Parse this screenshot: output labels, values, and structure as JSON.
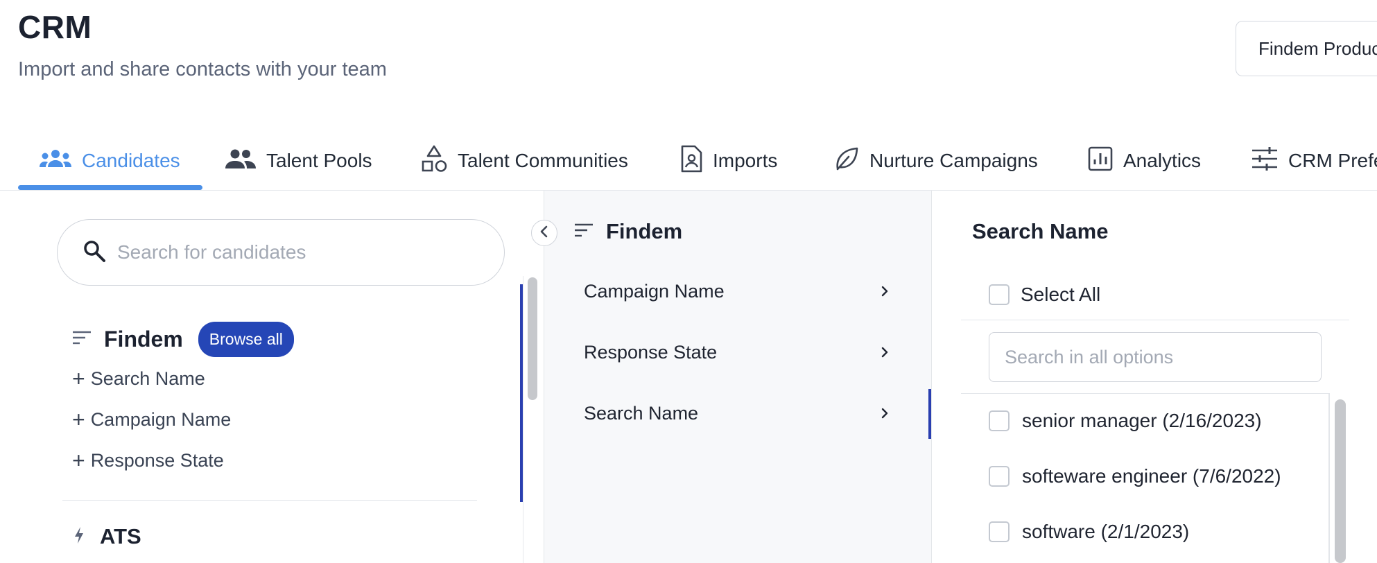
{
  "header": {
    "title": "CRM",
    "subtitle": "Import and share contacts with your team",
    "account_select_label": "Findem Product"
  },
  "tabs": [
    {
      "label": "Candidates",
      "icon": "people-group-icon",
      "active": true
    },
    {
      "label": "Talent Pools",
      "icon": "people-icon",
      "active": false
    },
    {
      "label": "Talent Communities",
      "icon": "shapes-icon",
      "active": false
    },
    {
      "label": "Imports",
      "icon": "contact-document-icon",
      "active": false
    },
    {
      "label": "Nurture Campaigns",
      "icon": "leaf-icon",
      "active": false
    },
    {
      "label": "Analytics",
      "icon": "bar-chart-icon",
      "active": false
    },
    {
      "label": "CRM Preferences",
      "icon": "sliders-icon",
      "active": false
    }
  ],
  "left_pane": {
    "search_placeholder": "Search for candidates",
    "findem_group": {
      "title": "Findem",
      "browse_all_label": "Browse all",
      "facets": [
        "Search Name",
        "Campaign Name",
        "Response State"
      ]
    },
    "ats_group": {
      "title": "ATS"
    }
  },
  "middle_pane": {
    "title": "Findem",
    "items": [
      {
        "label": "Campaign Name",
        "active": false
      },
      {
        "label": "Response State",
        "active": false
      },
      {
        "label": "Search Name",
        "active": true
      }
    ]
  },
  "right_pane": {
    "title": "Search Name",
    "select_all_label": "Select All",
    "options_search_placeholder": "Search in all options",
    "options": [
      {
        "label": "senior manager (2/16/2023)",
        "checked": false
      },
      {
        "label": "softeware engineer (7/6/2022)",
        "checked": false
      },
      {
        "label": "software (2/1/2023)",
        "checked": false
      }
    ]
  },
  "colors": {
    "accent_blue": "#4a8fe7",
    "button_navy": "#2546b6",
    "active_bar": "#2a3fb0",
    "text_dark": "#1c2230",
    "text_muted": "#5b6478"
  }
}
